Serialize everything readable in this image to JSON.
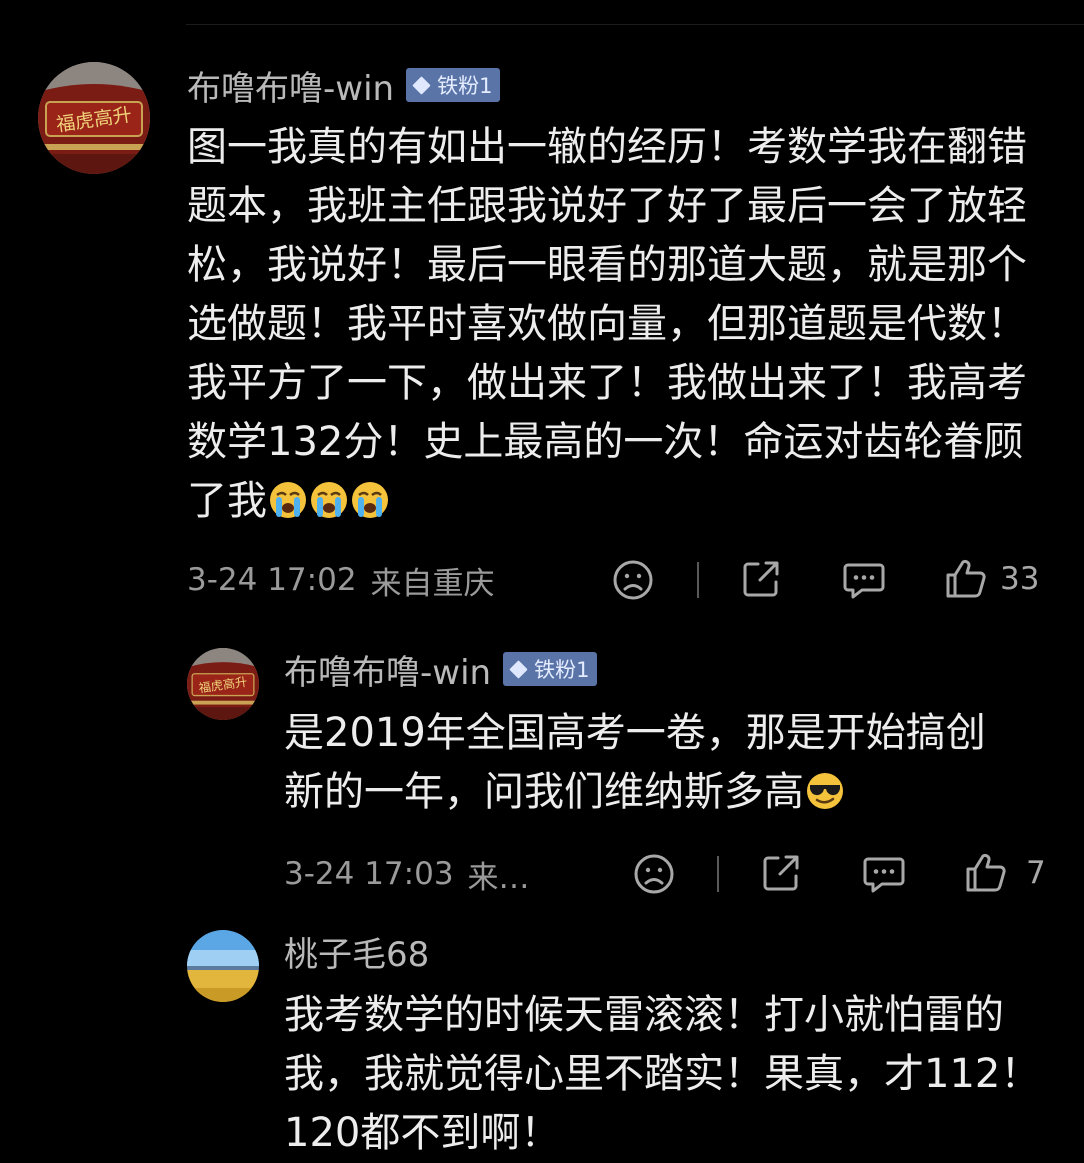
{
  "comments": [
    {
      "username": "布噜布噜-win",
      "badge": "铁粉1",
      "text": "图一我真的有如出一辙的经历！考数学我在翻错题本，我班主任跟我说好了好了最后一会了放轻松，我说好！最后一眼看的那道大题，就是那个选做题！我平时喜欢做向量，但那道题是代数！我平方了一下，做出来了！我做出来了！我高考数学132分！史上最高的一次！命运对齿轮眷顾了我",
      "emojis": [
        "crying-face",
        "crying-face",
        "crying-face"
      ],
      "date": "3-24 17:02",
      "location": "来自重庆",
      "likes": "33",
      "avatar_sign_text": "福虎高升"
    },
    {
      "username": "布噜布噜-win",
      "badge": "铁粉1",
      "text": "是2019年全国高考一卷，那是开始搞创新的一年，问我们维纳斯多高",
      "emojis": [
        "sunglasses-face"
      ],
      "date": "3-24 17:03",
      "location": "来…",
      "likes": "7",
      "avatar_sign_text": "福虎高升"
    },
    {
      "username": "桃子毛68",
      "text": "我考数学的时候天雷滚滚！打小就怕雷的我，我就觉得心里不踏实！果真，才112！120都不到啊！"
    }
  ],
  "icons": {
    "dislike": "sad-face-icon",
    "share": "share-icon",
    "reply": "comment-bubble-icon",
    "like": "thumbs-up-icon"
  },
  "colors": {
    "background": "#000000",
    "badge": "#5a74a8",
    "text": "#ededed",
    "meta": "#9a9a9a"
  }
}
